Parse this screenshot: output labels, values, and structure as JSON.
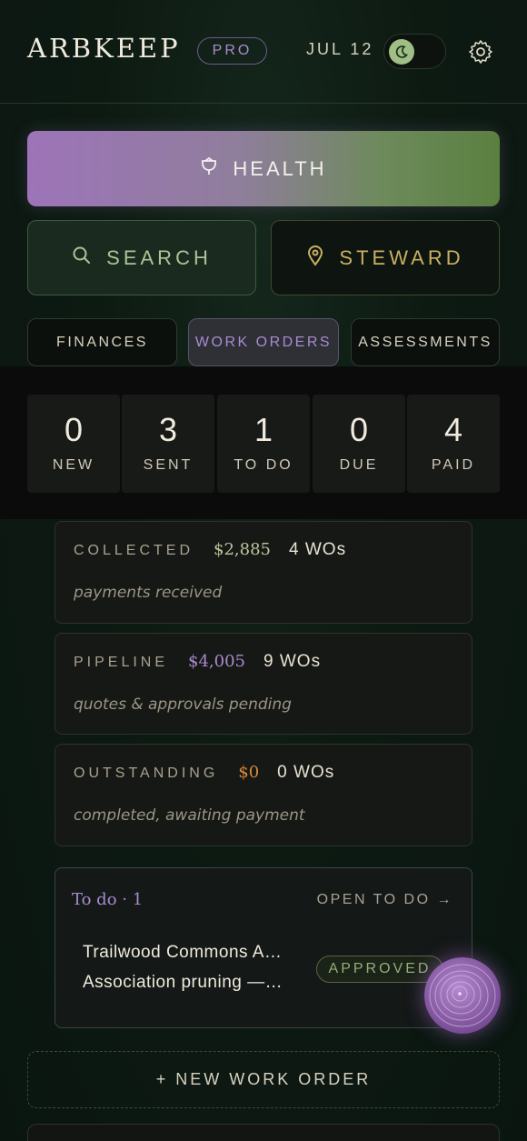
{
  "header": {
    "logo": "ARBKEEP",
    "plan_badge": "PRO",
    "date": "JUL 12",
    "theme_toggle": "dark"
  },
  "actions": {
    "health_label": "HEALTH",
    "search_label": "SEARCH",
    "steward_label": "STEWARD"
  },
  "tabs": [
    {
      "label": "FINANCES",
      "active": false
    },
    {
      "label": "WORK ORDERS",
      "active": true
    },
    {
      "label": "ASSESSMENTS",
      "active": false
    }
  ],
  "stats": [
    {
      "value": "0",
      "label": "NEW"
    },
    {
      "value": "3",
      "label": "SENT"
    },
    {
      "value": "1",
      "label": "TO DO"
    },
    {
      "value": "0",
      "label": "DUE"
    },
    {
      "value": "4",
      "label": "PAID"
    }
  ],
  "summary_cards": [
    {
      "title": "COLLECTED",
      "amount": "$2,885",
      "count": "4 WOs",
      "subtitle": "payments received",
      "amount_color": "#b9c6a0"
    },
    {
      "title": "PIPELINE",
      "amount": "$4,005",
      "count": "9 WOs",
      "subtitle": "quotes & approvals pending",
      "amount_color": "#a98bd0"
    },
    {
      "title": "OUTSTANDING",
      "amount": "$0",
      "count": "0 WOs",
      "subtitle": "completed, awaiting payment",
      "amount_color": "#d9893a"
    }
  ],
  "todo": {
    "title": "To do · 1",
    "link": "OPEN TO DO →",
    "item_line1": "Trailwood Commons A…",
    "item_line2": "Association pruning —…",
    "status": "APPROVED"
  },
  "new_work_order_label": "+ NEW WORK ORDER",
  "colors": {
    "accent_purple": "#a98bd0",
    "accent_green": "#a9c596",
    "accent_gold": "#c8b060"
  }
}
